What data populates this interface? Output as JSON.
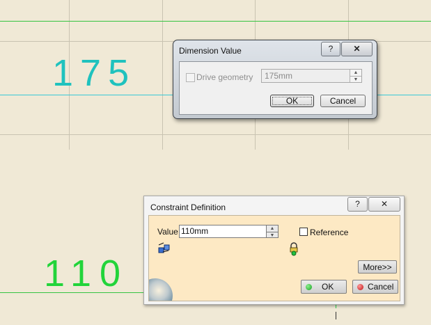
{
  "canvas": {
    "dimension_top": "175",
    "dimension_bottom": "110",
    "colors": {
      "background": "#f0e9d6",
      "green": "#22d43a",
      "cyan": "#1fc2be",
      "grid": "#c9c3b1"
    }
  },
  "dimension_dialog": {
    "title": "Dimension Value",
    "help_label": "?",
    "close_label": "✕",
    "drive_geometry_label": "Drive geometry",
    "drive_geometry_checked": false,
    "value": "175mm",
    "ok_label": "OK",
    "cancel_label": "Cancel"
  },
  "constraint_dialog": {
    "title": "Constraint Definition",
    "help_label": "?",
    "close_label": "✕",
    "value_label": "Value",
    "value": "110mm",
    "reference_label": "Reference",
    "reference_checked": false,
    "more_label": "More>>",
    "ok_label": "OK",
    "cancel_label": "Cancel",
    "icons": [
      "constraint-elements-icon",
      "lock-icon"
    ]
  }
}
